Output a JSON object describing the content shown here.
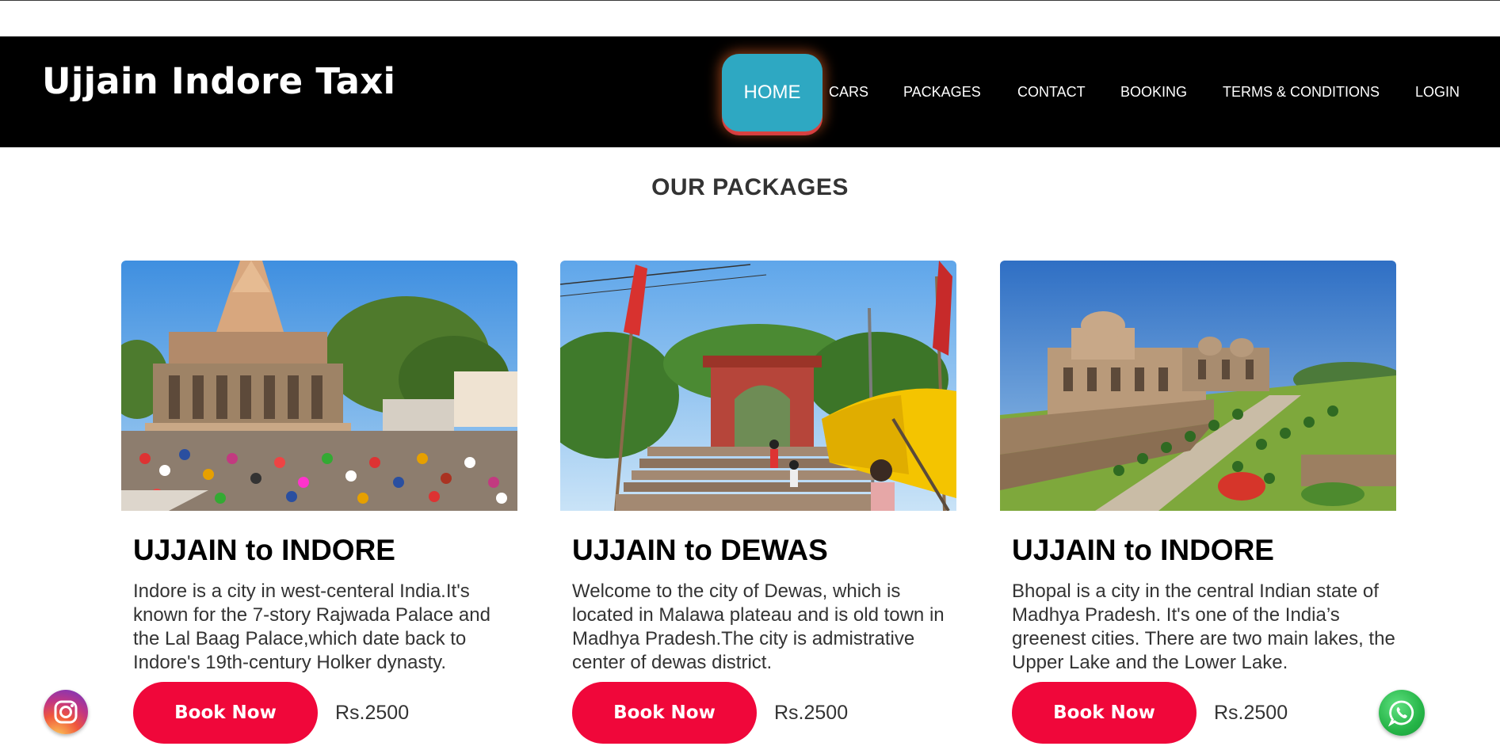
{
  "brand": {
    "name": "Ujjain Indore Taxi"
  },
  "nav": {
    "items": [
      {
        "label": "HOME",
        "active": true
      },
      {
        "label": "CARS"
      },
      {
        "label": "PACKAGES"
      },
      {
        "label": "CONTACT"
      },
      {
        "label": "BOOKING"
      },
      {
        "label": "TERMS & CONDITIONS"
      },
      {
        "label": "LOGIN"
      }
    ]
  },
  "section": {
    "title": "OUR PACKAGES"
  },
  "packages": [
    {
      "title": "UJJAIN to INDORE",
      "description": "Indore is a city in west-centeral India.It's known for the 7-story Rajwada Palace and the Lal Baag Palace,which date back to Indore's 19th-century Holker dynasty.",
      "button_label": "Book Now",
      "price": "Rs.2500",
      "image": "temple-crowd-photo"
    },
    {
      "title": "UJJAIN to DEWAS",
      "description": "Welcome to the city of Dewas, which is located in Malawa plateau and is old town in Madhya Pradesh.The city is admistrative center of dewas district.",
      "button_label": "Book Now",
      "price": "Rs.2500",
      "image": "temple-gate-stairs-photo"
    },
    {
      "title": "UJJAIN to INDORE",
      "description": "Bhopal is a city in the central Indian state of Madhya Pradesh. It's one of the India’s greenest cities. There are two main lakes, the Upper Lake and the Lower Lake.",
      "button_label": "Book Now",
      "price": "Rs.2500",
      "image": "palace-garden-photo"
    }
  ],
  "social": {
    "left": "instagram-icon",
    "right": "whatsapp-icon"
  },
  "colors": {
    "navbar": "#000000",
    "home_active": "#2ea8c2",
    "book_button": "#f0073a"
  }
}
